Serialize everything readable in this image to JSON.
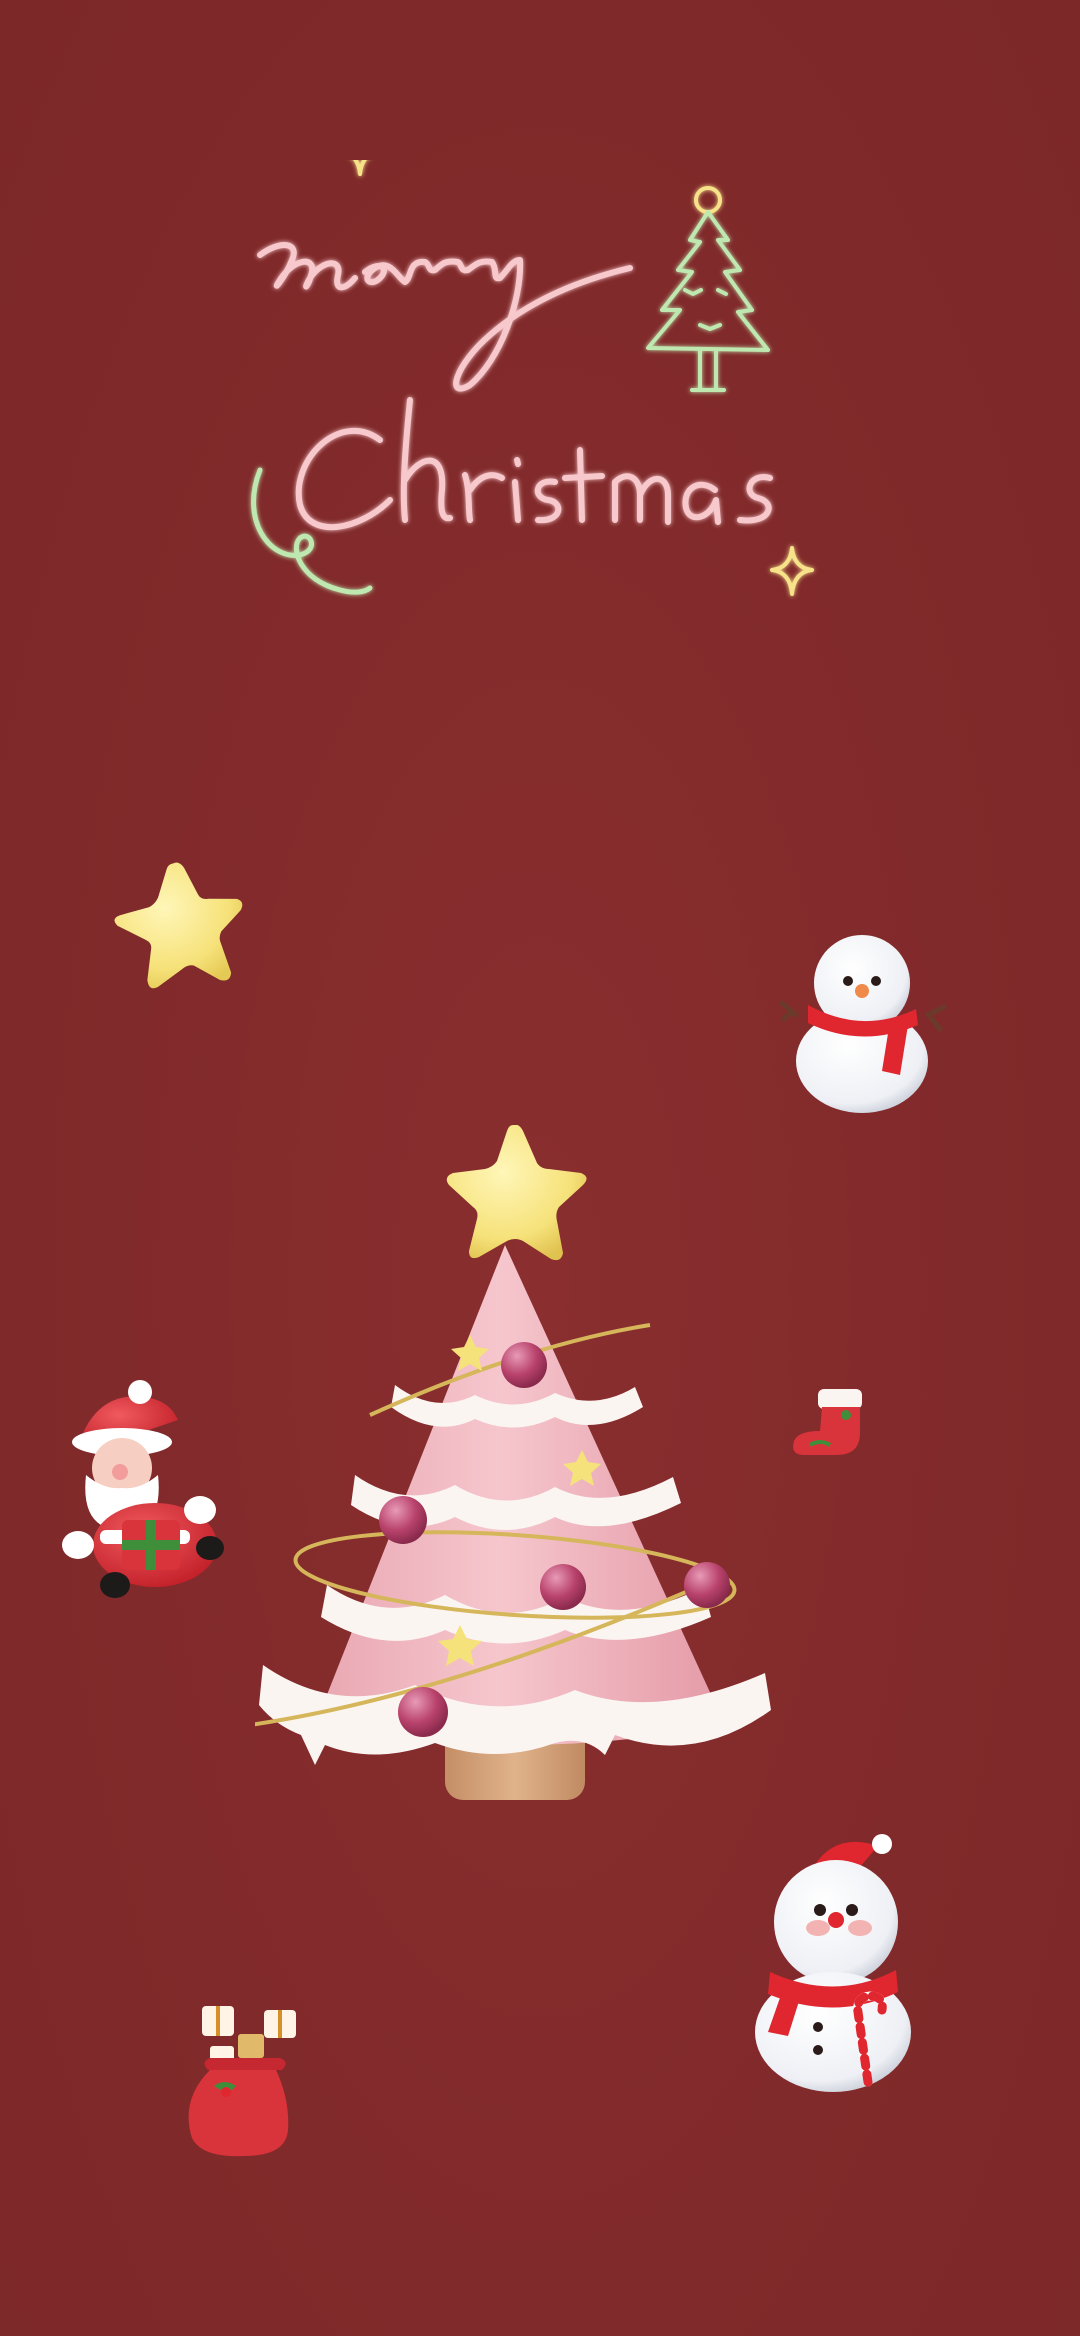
{
  "greeting": {
    "line1": "Merry",
    "line2": "Christmas"
  },
  "colors": {
    "background": "#812a2b",
    "tree_pink": "#f2b9c2",
    "frosting": "#fbf5f2",
    "star_yellow": "#f8e27a",
    "ornament": "#b8426b",
    "tinsel": "#d6b65a",
    "trunk": "#d4a27a",
    "santa_red": "#d9333b",
    "scarf_red": "#e0262f",
    "neon_pink": "#f7c9cc",
    "neon_green": "#bfe8b0",
    "neon_yellow": "#f7e28a"
  },
  "icons": [
    "neon-sparkle-icon",
    "neon-tree-icon",
    "star-icon",
    "snowman-icon",
    "christmas-tree-icon",
    "santa-icon",
    "stocking-icon",
    "gift-sack-icon"
  ]
}
